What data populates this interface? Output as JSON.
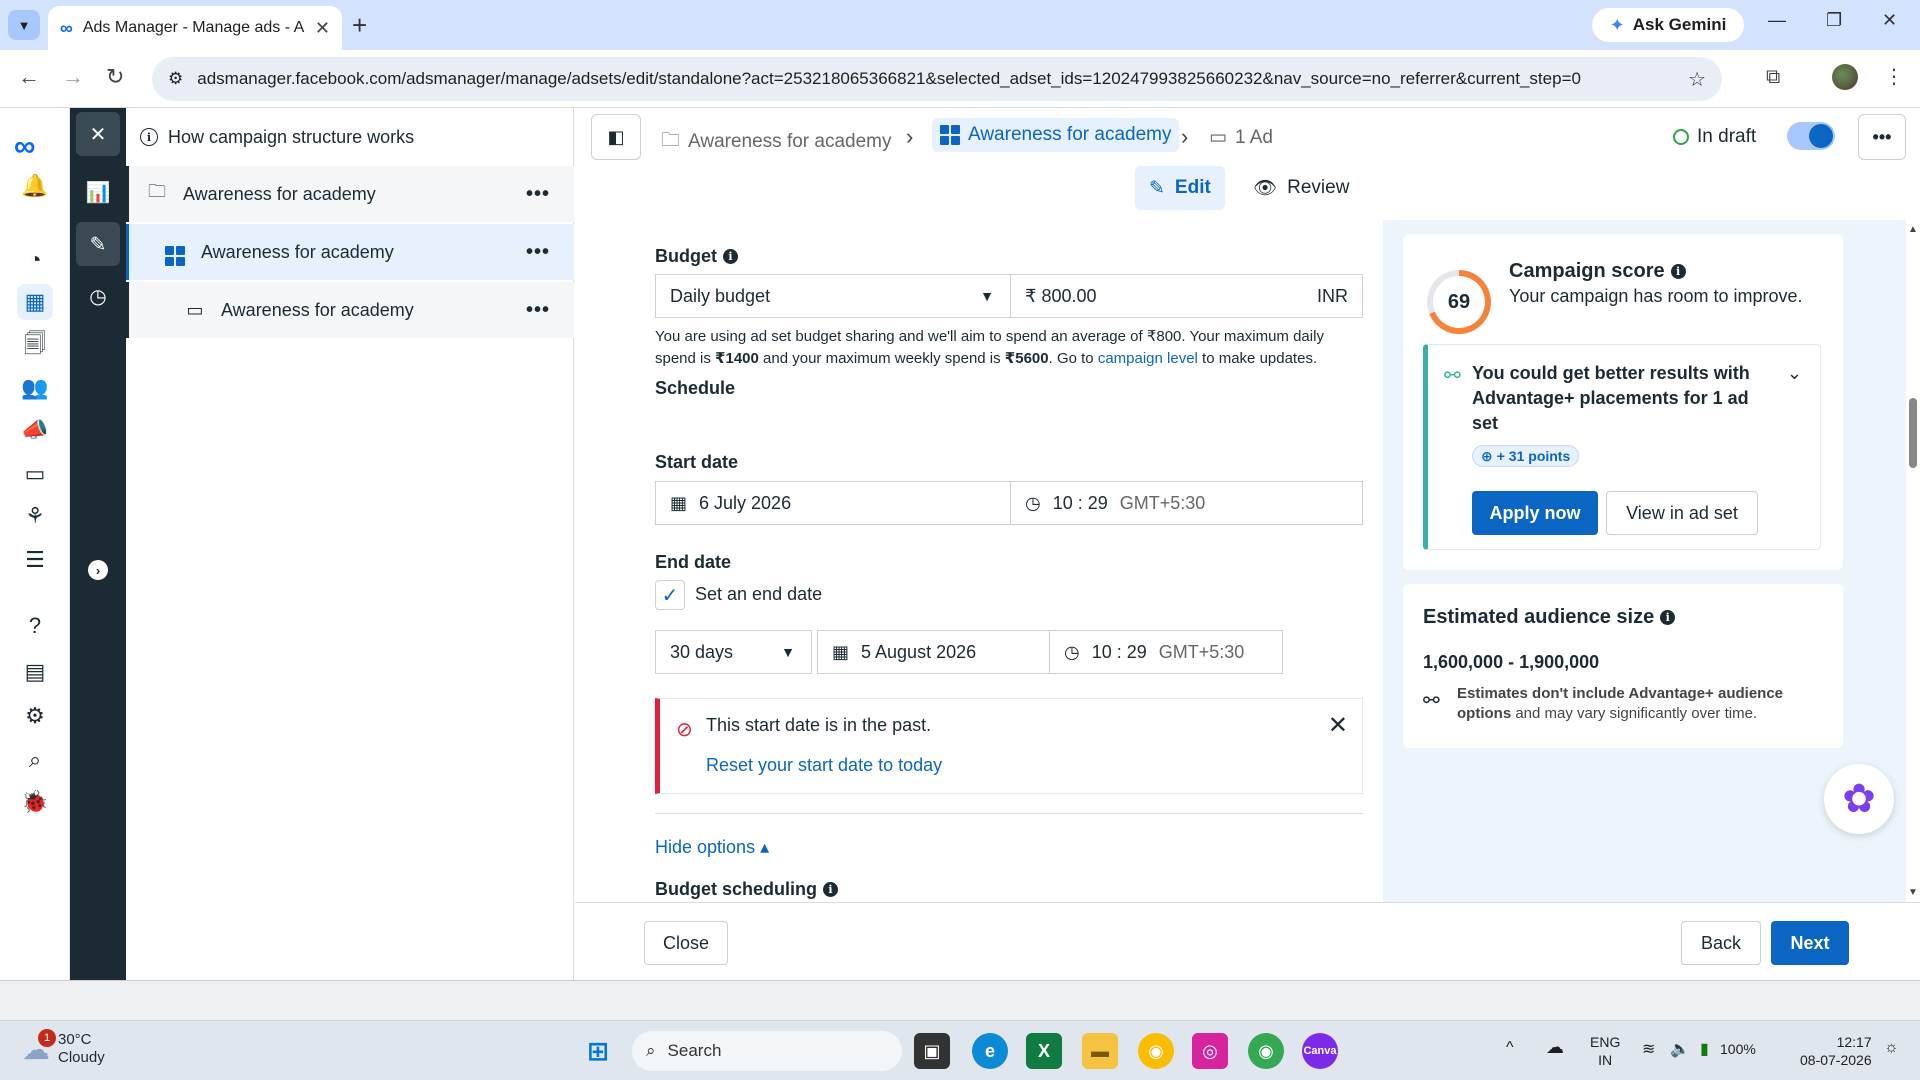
{
  "browser": {
    "tab_title": "Ads Manager - Manage ads - A",
    "gemini_label": "Ask Gemini",
    "url": "adsmanager.facebook.com/adsmanager/manage/adsets/edit/standalone?act=253218065366821&selected_adset_ids=120247993825660232&nav_source=no_referrer&current_step=0"
  },
  "tree": {
    "header": "How campaign structure works",
    "items": [
      {
        "label": "Awareness for academy",
        "level": "campaign"
      },
      {
        "label": "Awareness for academy",
        "level": "adset"
      },
      {
        "label": "Awareness for academy",
        "level": "ad"
      }
    ],
    "more": "•••"
  },
  "header": {
    "crumb_campaign": "Awareness for academy",
    "crumb_adset": "Awareness for academy",
    "crumb_ad": "1 Ad",
    "status": "In draft",
    "tab_edit": "Edit",
    "tab_review": "Review",
    "more": "•••"
  },
  "form": {
    "budget_label": "Budget",
    "budget_type": "Daily budget",
    "budget_amount": "₹ 800.00",
    "currency": "INR",
    "help_text_1": "You are using ad set budget sharing and we'll aim to spend an average of ₹800. Your maximum daily spend is ",
    "help_bold_1": "₹1400",
    "help_text_2": " and your maximum weekly spend is ",
    "help_bold_2": "₹5600",
    "help_text_3": ". Go to ",
    "help_link": "campaign level",
    "help_text_4": " to make updates.",
    "schedule_label": "Schedule",
    "start_date_label": "Start date",
    "start_date": "6 July 2026",
    "start_time": "10 : 29",
    "start_tz": "GMT+5:30",
    "end_date_label": "End date",
    "end_checkbox_label": "Set an end date",
    "end_checked": true,
    "duration": "30 days",
    "end_date": "5 August 2026",
    "end_time": "10 : 29",
    "end_tz": "GMT+5:30",
    "alert_message": "This start date is in the past.",
    "alert_link": "Reset your start date to today",
    "hide_options": "Hide options ▴",
    "budget_scheduling_label": "Budget scheduling"
  },
  "score": {
    "value": "69",
    "value_percent": 69,
    "title": "Campaign score",
    "subtitle": "Your campaign has room to improve.",
    "tip": "You could get better results with Advantage+ placements for 1 ad set",
    "points": "+ 31 points",
    "apply": "Apply now",
    "view": "View in ad set"
  },
  "audience": {
    "title": "Estimated audience size",
    "range": "1,600,000 - 1,900,000",
    "note_bold": "Estimates don't include Advantage+ audience options",
    "note_rest": " and may vary significantly over time."
  },
  "footer": {
    "close": "Close",
    "back": "Back",
    "next": "Next"
  },
  "taskbar": {
    "temp": "30°C",
    "condition": "Cloudy",
    "weather_badge": "1",
    "search": "Search",
    "lang_1": "ENG",
    "lang_2": "IN",
    "battery": "100%",
    "time": "12:17",
    "date": "08-07-2026"
  },
  "colors": {
    "accent": "#0a66c2",
    "error": "#e41e3f",
    "tip_border": "#38b2a6",
    "score_ring": "#f5833c"
  }
}
